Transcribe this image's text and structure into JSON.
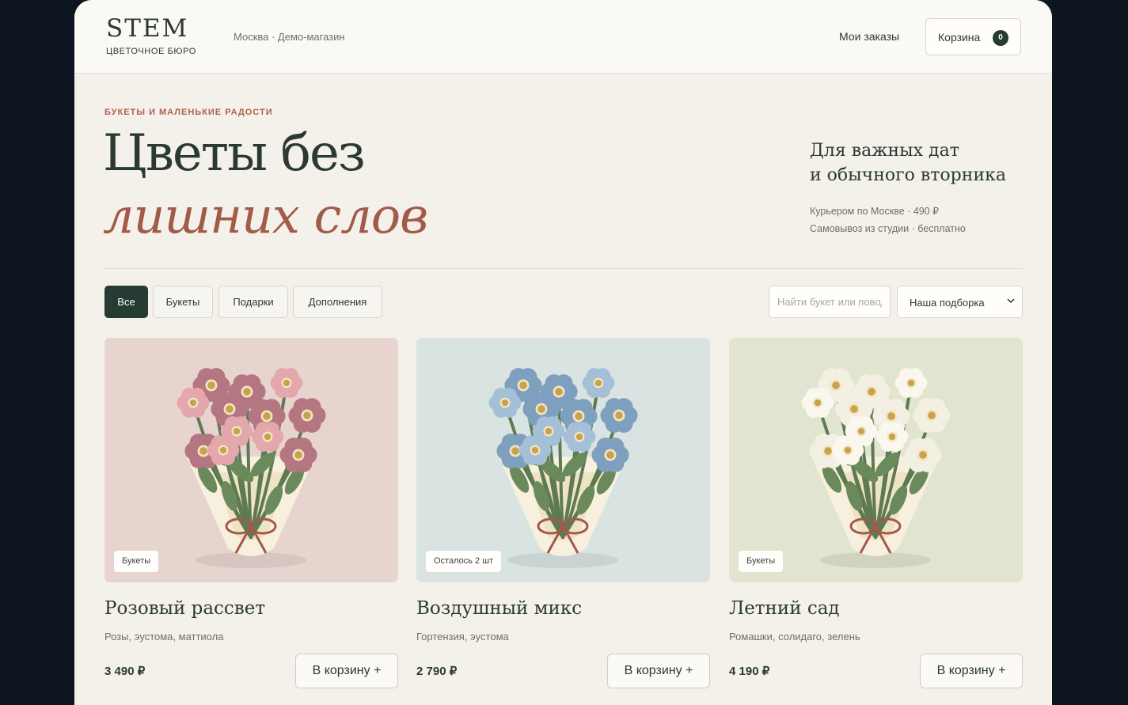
{
  "header": {
    "logo": "STEM",
    "logo_sub": "ЦВЕТОЧНОЕ БЮРО",
    "city": "Москва · Демо-магазин",
    "orders": "Мои заказы",
    "cart_label": "Корзина",
    "cart_count": "0"
  },
  "hero": {
    "eyebrow": "БУКЕТЫ И МАЛЕНЬКИЕ РАДОСТИ",
    "line1": "Цветы без",
    "line2": "лишних слов",
    "tagline1": "Для важных дат",
    "tagline2": "и обычного вторника",
    "delivery1": "Курьером по Москве · 490 ₽",
    "delivery2": "Самовывоз из студии · бесплатно"
  },
  "filters": {
    "chips": [
      "Все",
      "Букеты",
      "Подарки",
      "Дополнения"
    ],
    "active": "Все",
    "search_placeholder": "Найти букет или повод",
    "sort_value": "Наша подборка"
  },
  "products": [
    {
      "title": "Розовый рассвет",
      "desc": "Розы, эустома, маттиола",
      "price": "3 490 ₽",
      "badge": "Букеты",
      "add_label": "В корзину +",
      "bg": "#e7d4cf",
      "petal": "#b47782",
      "petal2": "#e3a7ac"
    },
    {
      "title": "Воздушный микс",
      "desc": "Гортензия, эустома",
      "price": "2 790 ₽",
      "badge": "Осталось 2 шт",
      "add_label": "В корзину +",
      "bg": "#d8e3e2",
      "petal": "#7e9fbd",
      "petal2": "#a5bfd6"
    },
    {
      "title": "Летний сад",
      "desc": "Ромашки, солидаго, зелень",
      "price": "4 190 ₽",
      "badge": "Букеты",
      "add_label": "В корзину +",
      "bg": "#e1e4cf",
      "petal": "#f3efe2",
      "petal2": "#faf7ee"
    }
  ],
  "colors": {
    "accent_dark": "#263b31",
    "accent_terracotta": "#a25a49"
  }
}
